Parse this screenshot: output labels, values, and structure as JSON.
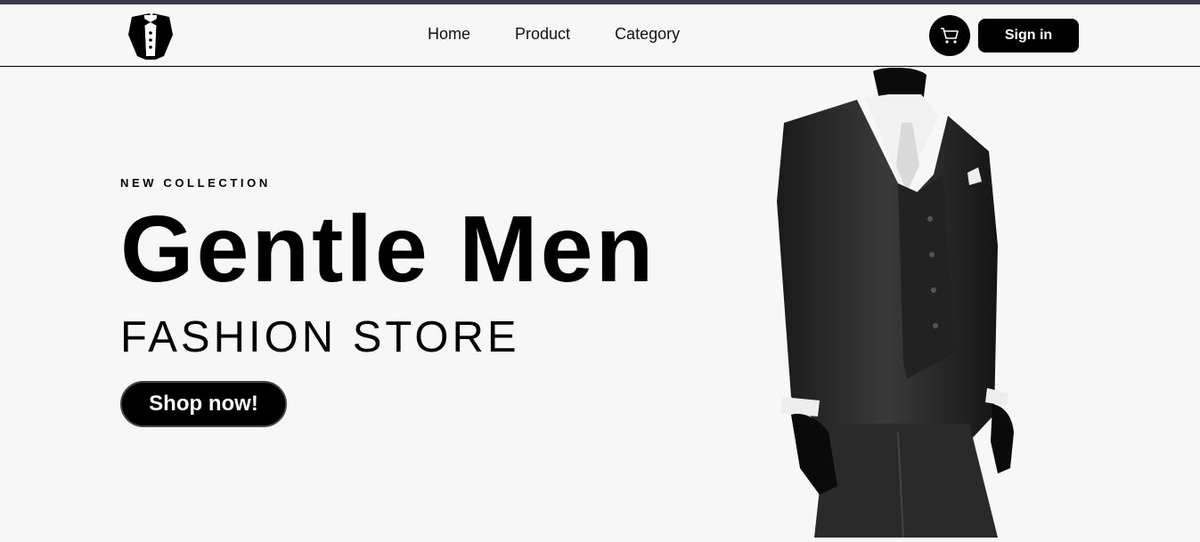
{
  "header": {
    "nav": [
      {
        "label": "Home"
      },
      {
        "label": "Product"
      },
      {
        "label": "Category"
      }
    ],
    "signin_label": "Sign in",
    "logo_icon": "tuxedo-logo-icon",
    "cart_icon": "shopping-cart-icon"
  },
  "hero": {
    "eyebrow": "NEW COLLECTION",
    "title": "Gentle Men",
    "subtitle": "FASHION STORE",
    "cta_label": "Shop now!"
  },
  "colors": {
    "background": "#f7f7f7",
    "accent": "#000000",
    "top_strip": "#3b3a4a"
  }
}
